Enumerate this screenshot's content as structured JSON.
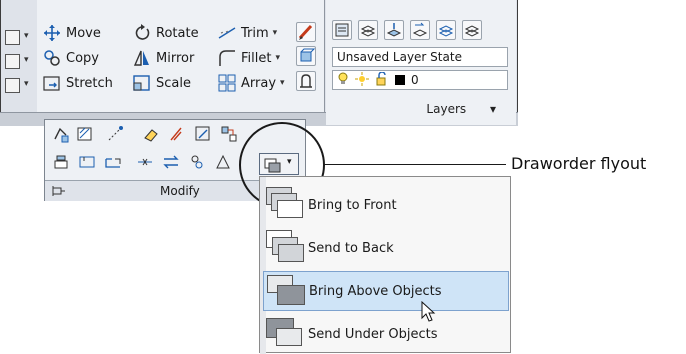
{
  "modify": {
    "move": "Move",
    "rotate": "Rotate",
    "trim": "Trim",
    "copy": "Copy",
    "mirror": "Mirror",
    "fillet": "Fillet",
    "stretch": "Stretch",
    "scale": "Scale",
    "array": "Array",
    "panel_title": "Modify",
    "dropdown_glyph": "▾"
  },
  "layers": {
    "layer_state": "Unsaved Layer State",
    "current_layer": "0",
    "panel_title": "Layers",
    "title_arrow": "▾"
  },
  "callout": {
    "label": "Draworder flyout"
  },
  "flyout": {
    "items": [
      {
        "label": "Bring to Front"
      },
      {
        "label": "Send to Back"
      },
      {
        "label": "Bring Above Objects"
      },
      {
        "label": "Send Under Objects"
      }
    ]
  },
  "colors": {
    "ribbon_bg": "#eef1f5",
    "highlight": "#cfe4f7",
    "highlight_border": "#7da2ce"
  }
}
